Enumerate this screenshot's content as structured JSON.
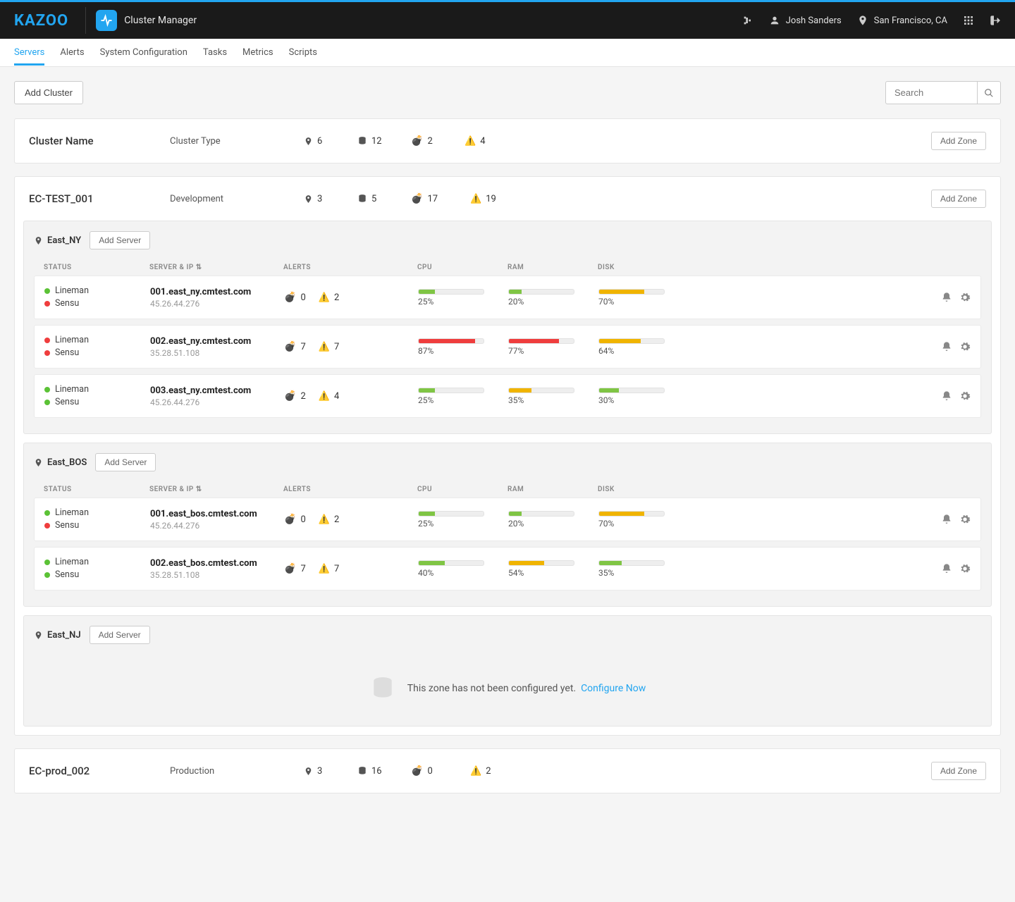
{
  "header": {
    "logo": "KAZOO",
    "app_title": "Cluster Manager",
    "user": "Josh Sanders",
    "location": "San Francisco, CA"
  },
  "nav": {
    "items": [
      "Servers",
      "Alerts",
      "System Configuration",
      "Tasks",
      "Metrics",
      "Scripts"
    ],
    "active": 0
  },
  "toolbar": {
    "add_cluster": "Add Cluster",
    "search_placeholder": "Search"
  },
  "columns": {
    "status": "STATUS",
    "server": "SERVER & IP",
    "alerts": "ALERTS",
    "cpu": "CPU",
    "ram": "RAM",
    "disk": "DISK"
  },
  "labels": {
    "add_zone": "Add Zone",
    "add_server": "Add Server",
    "empty_zone_text": "This zone has not been configured yet.",
    "configure_now": "Configure Now",
    "sort_suffix": "⇅"
  },
  "cluster_header_labels": {
    "name": "Cluster Name",
    "type": "Cluster Type",
    "zones": 6,
    "servers": 12,
    "critical": 2,
    "warnings": 4
  },
  "clusters": [
    {
      "name": "EC-TEST_001",
      "type": "Development",
      "stats": {
        "zones": 3,
        "servers": 5,
        "critical": 17,
        "warnings": 19
      },
      "zones": [
        {
          "name": "East_NY",
          "servers": [
            {
              "status": [
                {
                  "name": "Lineman",
                  "color": "green"
                },
                {
                  "name": "Sensu",
                  "color": "red"
                }
              ],
              "host": "001.east_ny.cmtest.com",
              "ip": "45.26.44.276",
              "critical": 0,
              "warnings": 2,
              "cpu": {
                "pct": 25,
                "label": "25%",
                "class": "green"
              },
              "ram": {
                "pct": 20,
                "label": "20%",
                "class": "green"
              },
              "disk": {
                "pct": 70,
                "label": "70%",
                "class": "yellow"
              }
            },
            {
              "status": [
                {
                  "name": "Lineman",
                  "color": "red"
                },
                {
                  "name": "Sensu",
                  "color": "red"
                }
              ],
              "host": "002.east_ny.cmtest.com",
              "ip": "35.28.51.108",
              "critical": 7,
              "warnings": 7,
              "cpu": {
                "pct": 87,
                "label": "87%",
                "class": "red"
              },
              "ram": {
                "pct": 77,
                "label": "77%",
                "class": "red"
              },
              "disk": {
                "pct": 64,
                "label": "64%",
                "class": "yellow"
              }
            },
            {
              "status": [
                {
                  "name": "Lineman",
                  "color": "green"
                },
                {
                  "name": "Sensu",
                  "color": "green"
                }
              ],
              "host": "003.east_ny.cmtest.com",
              "ip": "45.26.44.276",
              "critical": 2,
              "warnings": 4,
              "cpu": {
                "pct": 25,
                "label": "25%",
                "class": "green"
              },
              "ram": {
                "pct": 35,
                "label": "35%",
                "class": "yellow"
              },
              "disk": {
                "pct": 30,
                "label": "30%",
                "class": "green"
              }
            }
          ]
        },
        {
          "name": "East_BOS",
          "servers": [
            {
              "status": [
                {
                  "name": "Lineman",
                  "color": "green"
                },
                {
                  "name": "Sensu",
                  "color": "red"
                }
              ],
              "host": "001.east_bos.cmtest.com",
              "ip": "45.26.44.276",
              "critical": 0,
              "warnings": 2,
              "cpu": {
                "pct": 25,
                "label": "25%",
                "class": "green"
              },
              "ram": {
                "pct": 20,
                "label": "20%",
                "class": "green"
              },
              "disk": {
                "pct": 70,
                "label": "70%",
                "class": "yellow"
              }
            },
            {
              "status": [
                {
                  "name": "Lineman",
                  "color": "green"
                },
                {
                  "name": "Sensu",
                  "color": "green"
                }
              ],
              "host": "002.east_bos.cmtest.com",
              "ip": "35.28.51.108",
              "critical": 7,
              "warnings": 7,
              "cpu": {
                "pct": 40,
                "label": "40%",
                "class": "green"
              },
              "ram": {
                "pct": 54,
                "label": "54%",
                "class": "yellow"
              },
              "disk": {
                "pct": 35,
                "label": "35%",
                "class": "green"
              }
            }
          ]
        },
        {
          "name": "East_NJ",
          "servers": []
        }
      ]
    },
    {
      "name": "EC-prod_002",
      "type": "Production",
      "stats": {
        "zones": 3,
        "servers": 16,
        "critical": 0,
        "warnings": 2
      },
      "zones": []
    }
  ]
}
